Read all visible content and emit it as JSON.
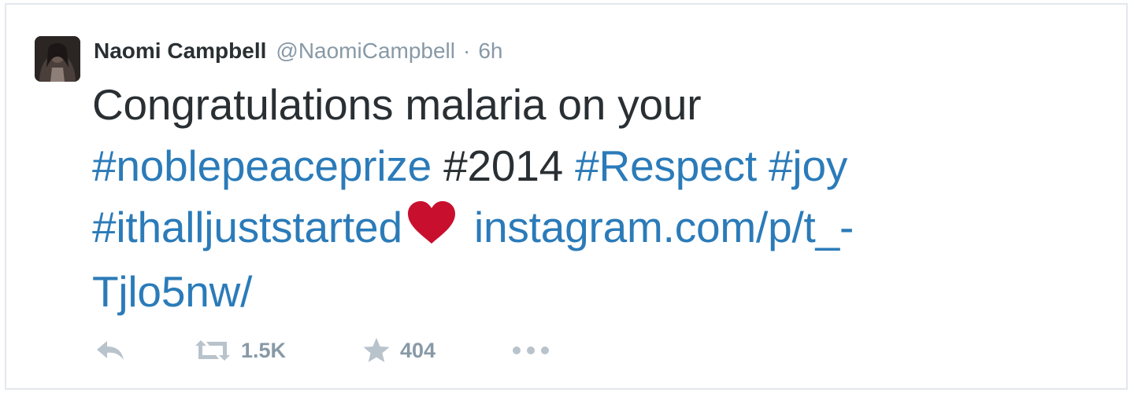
{
  "tweet": {
    "author_name": "Naomi Campbell",
    "author_handle": "@NaomiCampbell",
    "separator": "·",
    "timestamp": "6h",
    "text": {
      "line1": "Congratulations malaria on your",
      "line2_tag1": "#noblepeaceprize",
      "line2_tag2": "#2014",
      "line2_tag3": "#Respect",
      "line2_tag4": "#joy",
      "line3_tag": "#ithalljuststarted",
      "line3_link": "instagram.com/p/t_-",
      "line4_link": "Tjlo5nw/"
    },
    "actions": {
      "retweet_count": "1.5K",
      "favorite_count": "404"
    }
  },
  "colors": {
    "text": "#292f33",
    "muted": "#8899a6",
    "link": "#2b7bb9",
    "heart": "#c8102e",
    "border": "#e3e8ec"
  },
  "icons": [
    "avatar",
    "heart-emoji-icon",
    "reply-icon",
    "retweet-icon",
    "favorite-star-icon",
    "more-options-icon"
  ]
}
